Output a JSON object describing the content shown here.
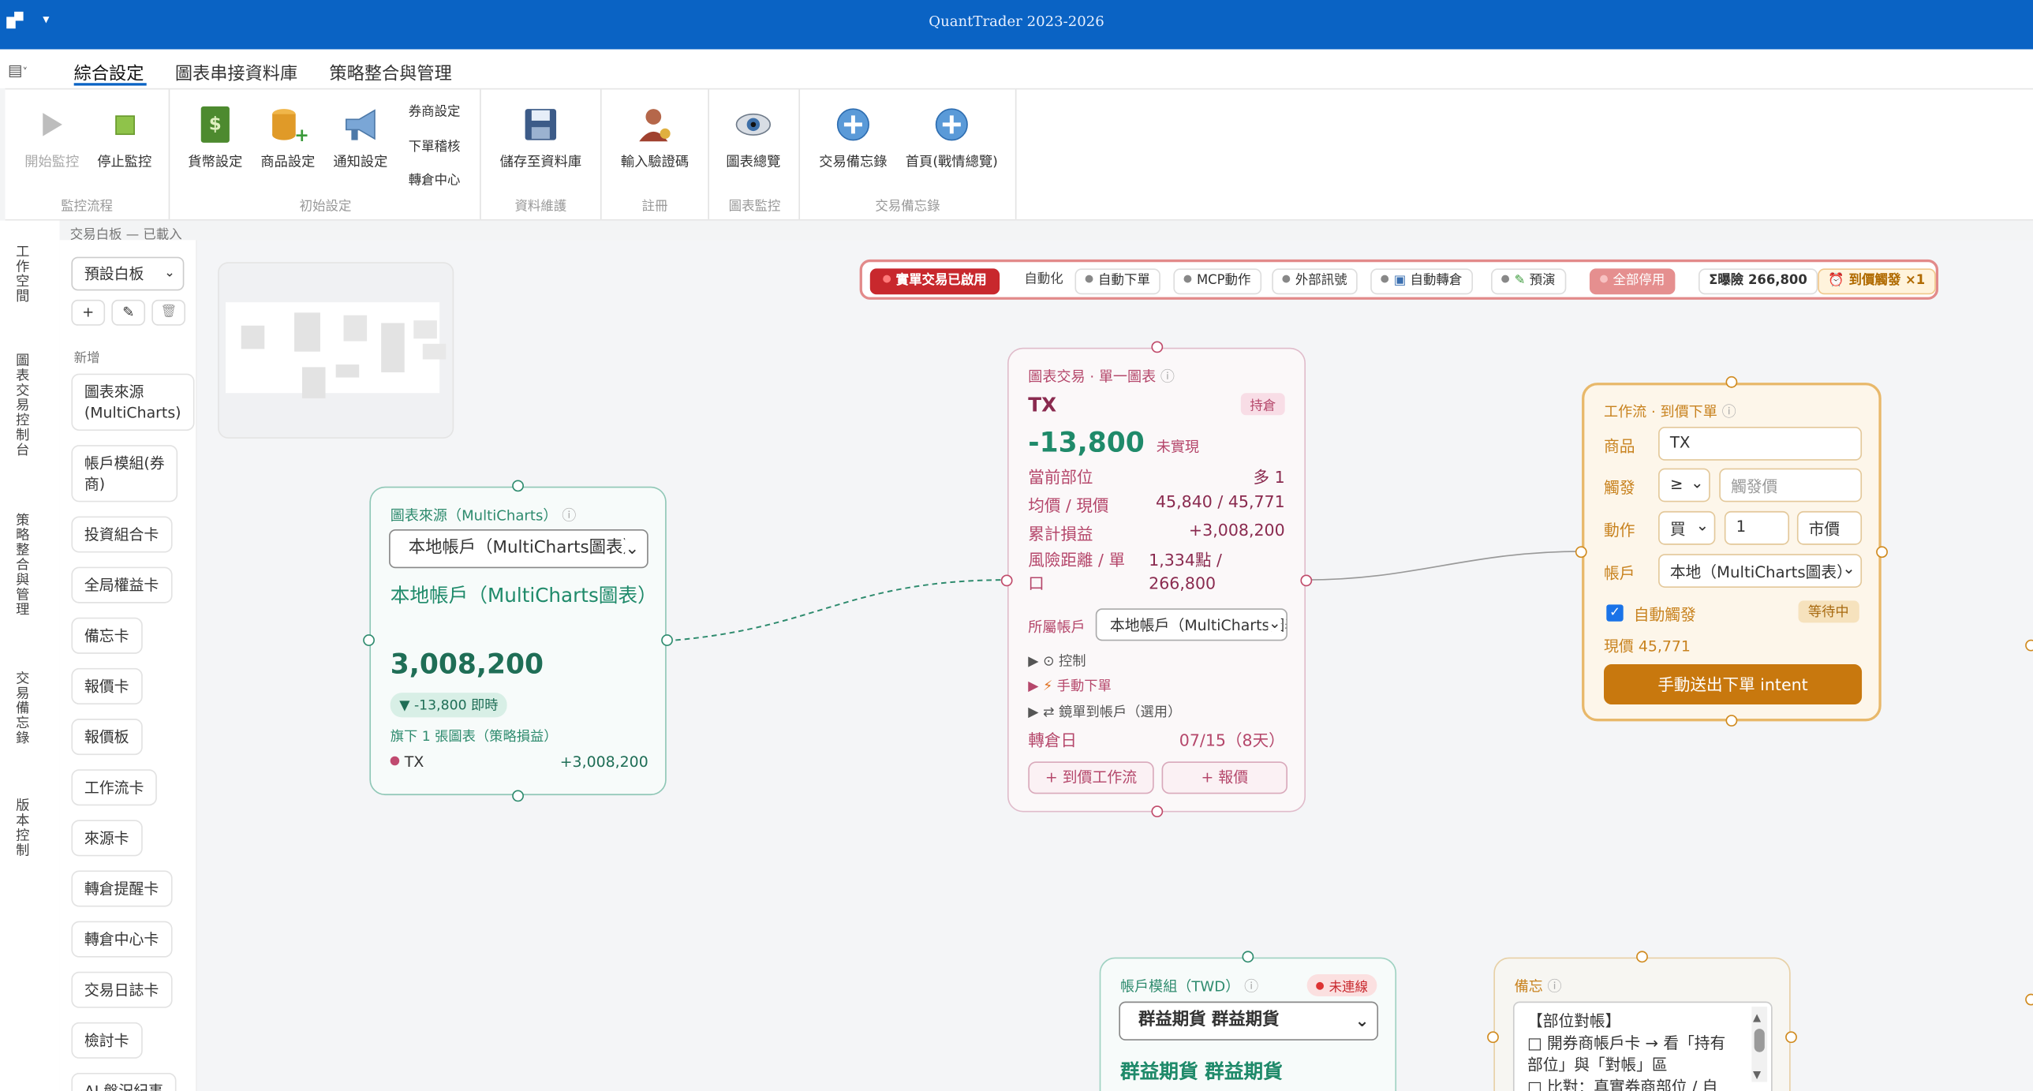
{
  "window": {
    "title": "QuantTrader 2023-2026"
  },
  "tabs": [
    {
      "label": "綜合設定"
    },
    {
      "label": "圖表串接資料庫"
    },
    {
      "label": "策略整合與管理"
    }
  ],
  "ribbon": {
    "groups": [
      {
        "label": "監控流程"
      },
      {
        "label": "初始設定"
      },
      {
        "label": "資料維護"
      },
      {
        "label": "註冊"
      },
      {
        "label": "圖表監控"
      },
      {
        "label": "交易備忘錄"
      }
    ],
    "buttons": {
      "start": "開始監控",
      "stop": "停止監控",
      "currency": "貨幣設定",
      "product": "商品設定",
      "notify": "通知設定",
      "broker": "券商設定",
      "audit": "下單稽核",
      "rollover": "轉倉中心",
      "save": "儲存至資料庫",
      "verify": "輸入驗證碼",
      "chart_overview": "圖表總覽",
      "memo": "交易備忘錄",
      "home": "首頁(戰情總覽)"
    }
  },
  "status_line": "交易白板 — 已載入",
  "rail": [
    "工作空間",
    "圖表交易控制台",
    "策略整合與管理",
    "交易備忘錄",
    "版本控制"
  ],
  "palette": {
    "preset": "預設白板",
    "add_label": "新增",
    "tools": [
      "+",
      "✎",
      "🗑"
    ],
    "items": [
      "圖表來源\n(MultiCharts)",
      "帳戶模組(券\n商)",
      "投資組合卡",
      "全局權益卡",
      "備忘卡",
      "報價卡",
      "報價板",
      "工作流卡",
      "來源卡",
      "轉倉提醒卡",
      "轉倉中心卡",
      "交易日誌卡",
      "檢討卡",
      "AI 盤況紀事"
    ]
  },
  "toolbar": {
    "live": "實單交易已啟用",
    "automation": "自動化",
    "manual_order": "自動下單",
    "mcp": "MCP動作",
    "external": "外部訊號",
    "auto_roll": "自動轉倉",
    "rehearsal": "預演",
    "disable_all": "全部停用",
    "exposure": "Σ曝險 266,800",
    "triggered": "到價觸發 ×1"
  },
  "source_card": {
    "header": "圖表來源（MultiCharts）",
    "select": "本地帳戶（MultiCharts圖表）",
    "name": "本地帳戶（MultiCharts圖表）",
    "equity": "3,008,200",
    "delta": "▼ -13,800 即時",
    "sub": "旗下 1 張圖表（策略損益）",
    "item_name": "TX",
    "item_value": "+3,008,200"
  },
  "chart_card": {
    "header": "圖表交易 · 單一圖表",
    "symbol": "TX",
    "badge": "持倉",
    "pnl": "-13,800",
    "pnl_note": "未實現",
    "rows": [
      {
        "k": "當前部位",
        "v": "多 1"
      },
      {
        "k": "均價 / 現價",
        "v": "45,840 / 45,771"
      },
      {
        "k": "累計損益",
        "v": "+3,008,200"
      },
      {
        "k": "風險距離 / 單口",
        "v": "1,334點 / 266,800"
      }
    ],
    "account_label": "所屬帳戶",
    "account_value": "本地帳戶（MultiCharts圖表）",
    "control": "⊙ 控制",
    "manual": "手動下單",
    "mirror": "⇄ 鏡單到帳戶（選用）",
    "roll_label": "轉倉日",
    "roll_value": "07/15（8天）",
    "btn_workflow": "+ 到價工作流",
    "btn_quote": "+ 報價"
  },
  "workflow_card": {
    "header": "工作流 · 到價下單",
    "product_label": "商品",
    "product_value": "TX",
    "trigger_label": "觸發",
    "trigger_op": "≥",
    "trigger_placeholder": "觸發價",
    "action_label": "動作",
    "action_side": "買",
    "action_qty": "1",
    "action_type": "市價",
    "account_label": "帳戶",
    "account_value": "本地（MultiCharts圖表）",
    "auto_trigger": "自動觸發",
    "status": "等待中",
    "price": "現價 45,771",
    "send": "手動送出下單 intent"
  },
  "account_card": {
    "header": "帳戶模組（TWD）",
    "status": "未連線",
    "select": "群益期貨 群益期貨",
    "name": "群益期貨 群益期貨"
  },
  "memo_card": {
    "header": "備忘",
    "lines": [
      "【部位對帳】",
      "□ 開券商帳戶卡 → 看「持有",
      "部位」與「對帳」區",
      "□ 比對：真實券商部位 / 自"
    ]
  },
  "colors": {
    "titlebar": "#0a63c4",
    "source_accent": "#1f8a6a",
    "chart_accent": "#b5476b",
    "workflow_accent": "#d08a1e",
    "send_button": "#c8780e",
    "live_red": "#c8282d"
  }
}
